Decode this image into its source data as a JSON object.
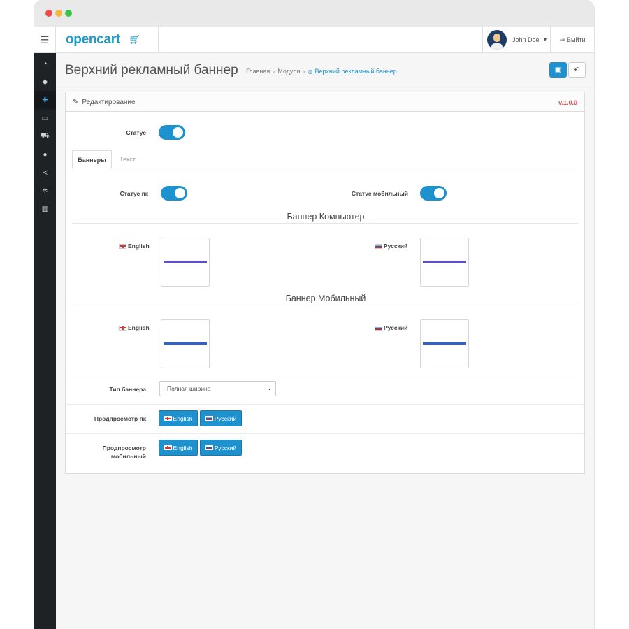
{
  "header": {
    "logo": "opencart",
    "logo_icon": "cart-icon",
    "user_name": "John Doe",
    "logout_label": "Выйти"
  },
  "sidebar": {
    "items": [
      {
        "icon": "dashboard-icon"
      },
      {
        "icon": "tags-icon"
      },
      {
        "icon": "puzzle-icon",
        "active": true
      },
      {
        "icon": "monitor-icon"
      },
      {
        "icon": "cart-icon"
      },
      {
        "icon": "user-icon"
      },
      {
        "icon": "share-icon"
      },
      {
        "icon": "gear-icon"
      },
      {
        "icon": "bar-chart-icon"
      }
    ]
  },
  "page": {
    "title": "Верхний рекламный баннер",
    "breadcrumb": [
      "Главная",
      "Модули",
      "Верхний рекламный баннер"
    ]
  },
  "panel": {
    "heading": "Редактирование",
    "version": "v.1.0.0",
    "status_label": "Статус",
    "tabs": [
      "Баннеры",
      "Текст"
    ],
    "status_pc_label": "Статус пк",
    "status_mobile_label": "Статус мобильный",
    "banner_pc_title": "Баннер Компьютер",
    "banner_mobile_title": "Баннер Мобильный",
    "lang_english": "English",
    "lang_russian": "Русский",
    "banner_type_label": "Тип баннера",
    "banner_type_value": "Полная ширина",
    "preview_pc_label": "Продпросмотр пк",
    "preview_mobile_label_1": "Продпросмотр",
    "preview_mobile_label_2": "мобильный"
  },
  "colors": {
    "accent": "#1e91cf",
    "sidebar_bg": "#1e2226",
    "version_red": "#d9534f",
    "banner_pc_line": "#5b4fd1",
    "banner_mobile_line": "#2f63c6"
  }
}
